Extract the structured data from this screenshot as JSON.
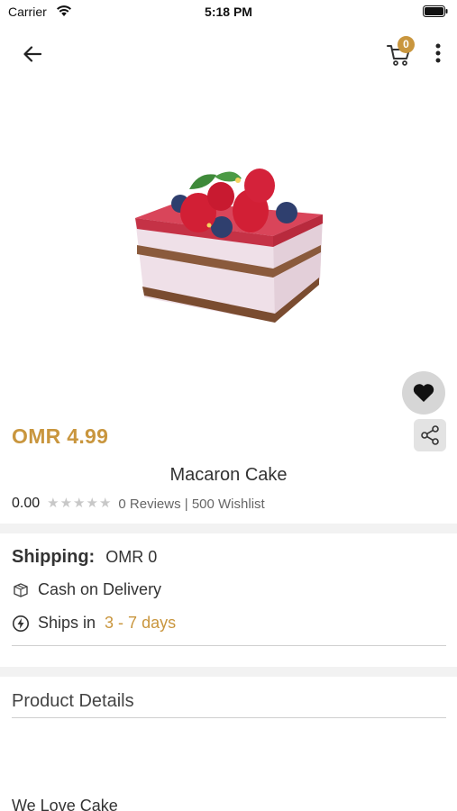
{
  "status_bar": {
    "carrier": "Carrier",
    "time": "5:18 PM"
  },
  "header": {
    "cart_count": "0"
  },
  "product": {
    "price": "OMR 4.99",
    "name": "Macaron Cake",
    "rating_value": "0.00",
    "rating_stars": 0,
    "reviews_text": "0 Reviews | 500 Wishlist"
  },
  "shipping": {
    "label": "Shipping:",
    "value": "OMR 0",
    "cod_text": "Cash on Delivery",
    "ships_in_label": "Ships in",
    "ships_in_days": "3 - 7 days"
  },
  "details": {
    "title": "Product Details",
    "description": "We Love Cake"
  },
  "colors": {
    "accent": "#c9963e",
    "star_empty": "#c8c8c8",
    "band": "#f2f2f2"
  },
  "icons": [
    "wifi-icon",
    "battery-icon",
    "back-arrow-icon",
    "cart-icon",
    "more-vertical-icon",
    "heart-icon",
    "share-icon",
    "box-icon",
    "lightning-icon",
    "star-icon"
  ]
}
